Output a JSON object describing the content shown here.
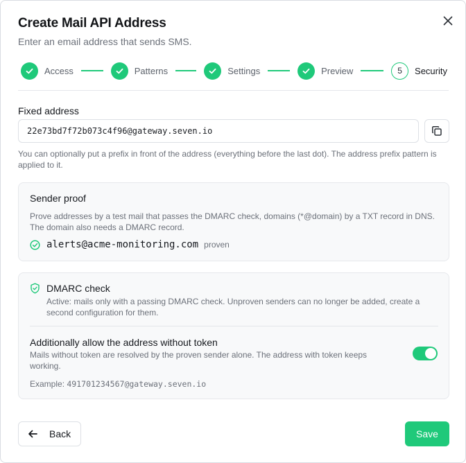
{
  "dialog": {
    "title": "Create Mail API Address",
    "subtitle": "Enter an email address that sends SMS.",
    "close_icon": "close-icon"
  },
  "stepper": {
    "steps": [
      {
        "label": "Access",
        "state": "done"
      },
      {
        "label": "Patterns",
        "state": "done"
      },
      {
        "label": "Settings",
        "state": "done"
      },
      {
        "label": "Preview",
        "state": "done"
      },
      {
        "label": "Security",
        "state": "active",
        "number": "5"
      }
    ]
  },
  "fixed_address": {
    "label": "Fixed address",
    "value": "22e73bd7f72b073c4f96@gateway.seven.io",
    "copy_icon": "copy-icon",
    "hint": "You can optionally put a prefix in front of the address (everything before the last dot). The address prefix pattern is applied to it."
  },
  "sender_proof": {
    "title": "Sender proof",
    "description": "Prove addresses by a test mail that passes the DMARC check, domains (*@domain) by a TXT record in DNS. The domain also needs a DMARC record.",
    "sender": {
      "email": "alerts@acme-monitoring.com",
      "status": "proven",
      "icon": "check-circle-icon"
    }
  },
  "dmarc": {
    "title": "DMARC check",
    "icon": "shield-check-icon",
    "description": "Active: mails only with a passing DMARC check. Unproven senders can no longer be added, create a second configuration for them.",
    "allow_without_token": {
      "title": "Additionally allow the address without token",
      "description": "Mails without token are resolved by the proven sender alone. The address with token keeps working.",
      "enabled": true
    },
    "example_label": "Example:",
    "example_value": "491701234567@gateway.seven.io"
  },
  "footer": {
    "back_label": "Back",
    "back_icon": "arrow-left-icon",
    "save_label": "Save"
  },
  "colors": {
    "accent": "#1fc97a",
    "text": "#15181d",
    "muted": "#6b7079",
    "border": "#dde0e5",
    "card_bg": "#f8f9fa"
  }
}
